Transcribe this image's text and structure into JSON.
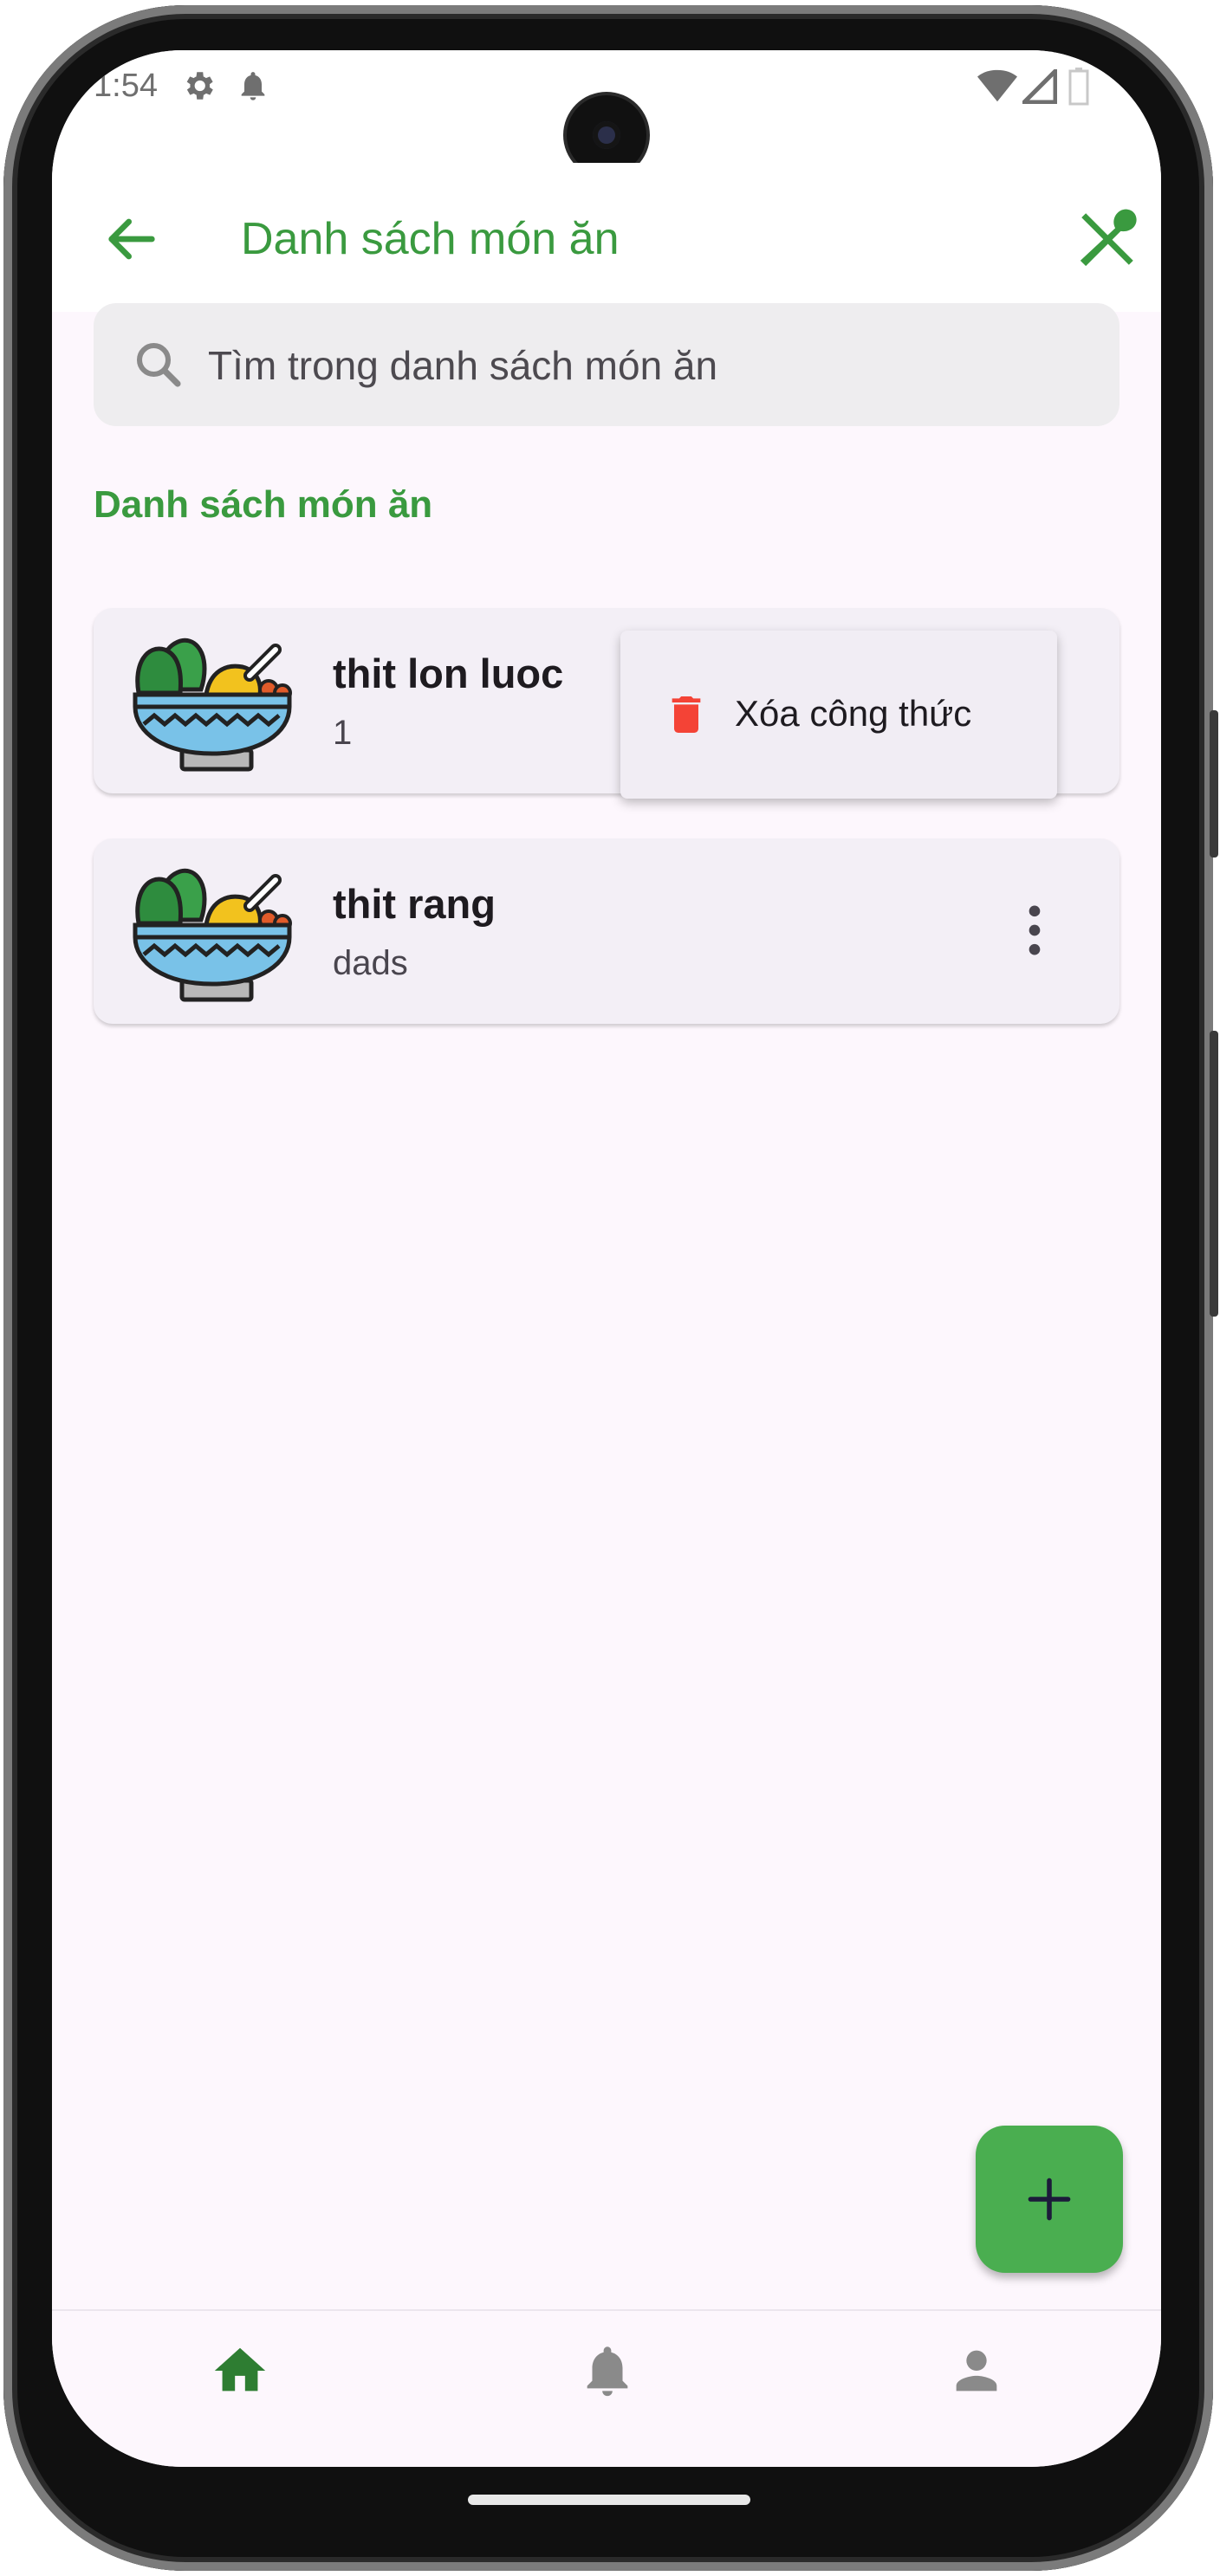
{
  "status_bar": {
    "time": "1:54",
    "icons": [
      "settings-icon",
      "notification-bell-icon",
      "wifi-icon",
      "cell-signal-icon",
      "battery-icon"
    ]
  },
  "app_bar": {
    "title": "Danh sách món ăn",
    "back_icon": "arrow-left-icon",
    "action_icon": "cutlery-icon"
  },
  "search": {
    "placeholder": "Tìm trong danh sách món ăn",
    "value": ""
  },
  "section": {
    "title": "Danh sách món ăn"
  },
  "dishes": [
    {
      "name": "thit lon luoc",
      "description": "1",
      "image": "food-bowl-icon"
    },
    {
      "name": "thit rang",
      "description": "dads",
      "image": "food-bowl-icon"
    }
  ],
  "popup_menu": {
    "items": [
      {
        "label": "Xóa công thức",
        "icon": "trash-icon"
      }
    ]
  },
  "fab": {
    "icon": "plus-icon"
  },
  "bottom_nav": {
    "items": [
      {
        "icon": "home-icon",
        "active": true
      },
      {
        "icon": "bell-icon",
        "active": false
      },
      {
        "icon": "person-icon",
        "active": false
      }
    ]
  },
  "colors": {
    "accent_green": "#3a9a3f",
    "fab_green": "#4aae50",
    "delete_red": "#f44336",
    "background": "#fdf7fd",
    "card": "#f3eff6"
  }
}
